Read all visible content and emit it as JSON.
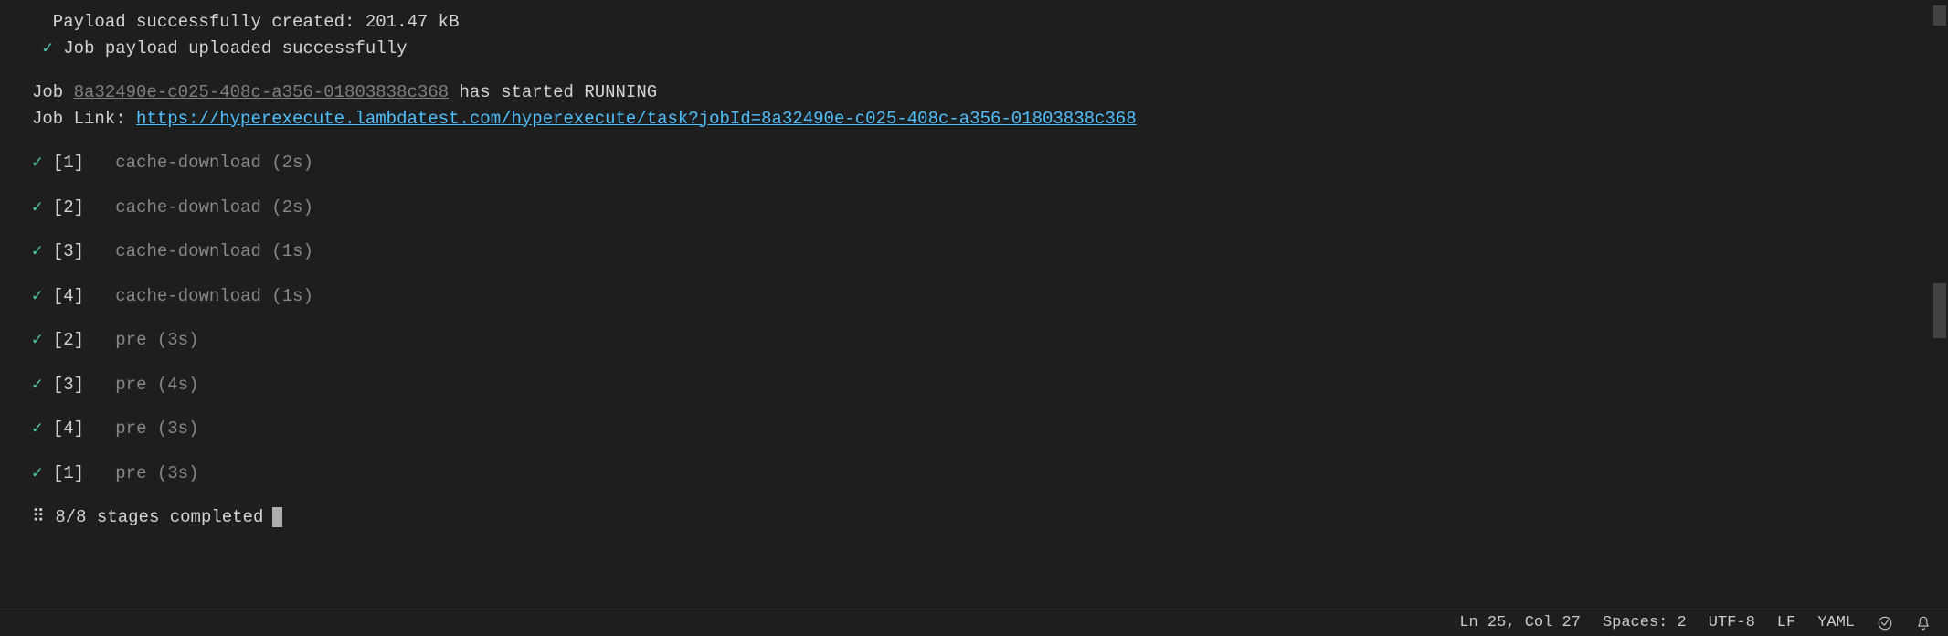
{
  "terminal": {
    "payload_line": "  Payload successfully created: 201.47 kB",
    "upload_line": "Job payload uploaded successfully",
    "job_started_prefix": "Job ",
    "job_id": "8a32490e-c025-408c-a356-01803838c368",
    "job_started_mid": " has started ",
    "job_started_status": "RUNNING",
    "job_link_label": "Job Link: ",
    "job_link_url": "https://hyperexecute.lambdatest.com/hyperexecute/task?jobId=8a32490e-c025-408c-a356-01803838c368",
    "stages_spinner": "⠿",
    "stages_completed": "8/8 stages completed",
    "check_glyph": "✓"
  },
  "stages": [
    {
      "index": "[1]",
      "label": "cache-download (2s)"
    },
    {
      "index": "[2]",
      "label": "cache-download (2s)"
    },
    {
      "index": "[3]",
      "label": "cache-download (1s)"
    },
    {
      "index": "[4]",
      "label": "cache-download (1s)"
    },
    {
      "index": "[2]",
      "label": "pre (3s)"
    },
    {
      "index": "[3]",
      "label": "pre (4s)"
    },
    {
      "index": "[4]",
      "label": "pre (3s)"
    },
    {
      "index": "[1]",
      "label": "pre (3s)"
    }
  ],
  "statusbar": {
    "cursor_pos": "Ln 25, Col 27",
    "indent": "Spaces: 2",
    "encoding": "UTF-8",
    "eol": "LF",
    "language": "YAML"
  }
}
